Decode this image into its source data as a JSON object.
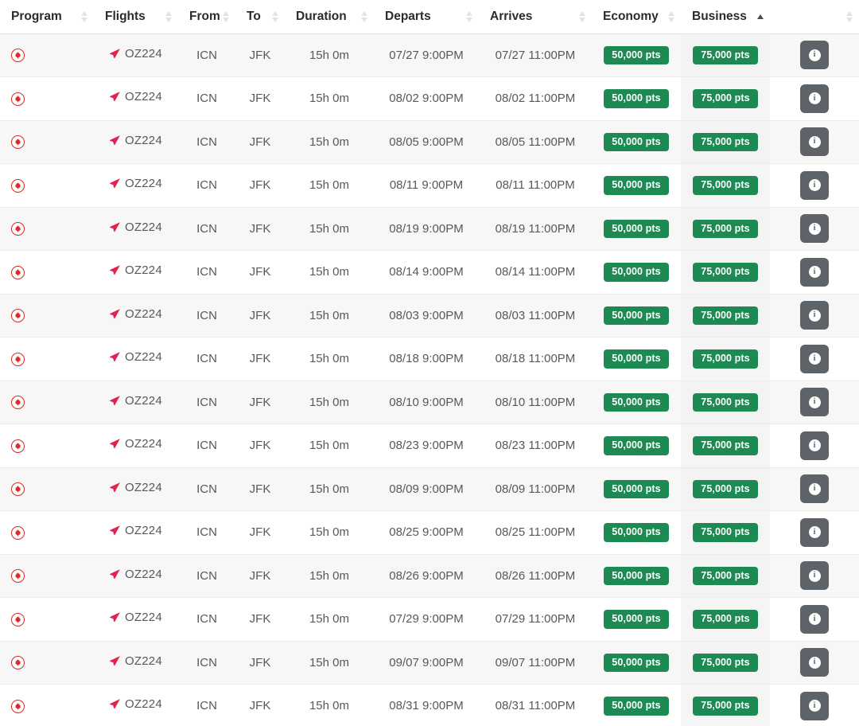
{
  "table": {
    "columns": [
      {
        "key": "program",
        "label": "Program",
        "sortable": true,
        "sort_state": "none"
      },
      {
        "key": "flights",
        "label": "Flights",
        "sortable": true,
        "sort_state": "none"
      },
      {
        "key": "from",
        "label": "From",
        "sortable": true,
        "sort_state": "none"
      },
      {
        "key": "to",
        "label": "To",
        "sortable": true,
        "sort_state": "none"
      },
      {
        "key": "duration",
        "label": "Duration",
        "sortable": true,
        "sort_state": "none"
      },
      {
        "key": "departs",
        "label": "Departs",
        "sortable": true,
        "sort_state": "none"
      },
      {
        "key": "arrives",
        "label": "Arrives",
        "sortable": true,
        "sort_state": "none"
      },
      {
        "key": "economy",
        "label": "Economy",
        "sortable": true,
        "sort_state": "none"
      },
      {
        "key": "business",
        "label": "Business",
        "sortable": true,
        "sort_state": "asc"
      },
      {
        "key": "actions",
        "label": "",
        "sortable": true,
        "sort_state": "none"
      }
    ],
    "program_icon": "aeroplan-maple-leaf-icon",
    "flight_icon": "airplane-icon",
    "info_icon": "info-circle-icon",
    "info_button_label": "i",
    "rows": [
      {
        "program": "Aeroplan",
        "flight": "OZ224",
        "from": "ICN",
        "to": "JFK",
        "duration": "15h 0m",
        "departs": "07/27 9:00PM",
        "arrives": "07/27 11:00PM",
        "economy": "50,000 pts",
        "business": "75,000 pts"
      },
      {
        "program": "Aeroplan",
        "flight": "OZ224",
        "from": "ICN",
        "to": "JFK",
        "duration": "15h 0m",
        "departs": "08/02 9:00PM",
        "arrives": "08/02 11:00PM",
        "economy": "50,000 pts",
        "business": "75,000 pts"
      },
      {
        "program": "Aeroplan",
        "flight": "OZ224",
        "from": "ICN",
        "to": "JFK",
        "duration": "15h 0m",
        "departs": "08/05 9:00PM",
        "arrives": "08/05 11:00PM",
        "economy": "50,000 pts",
        "business": "75,000 pts"
      },
      {
        "program": "Aeroplan",
        "flight": "OZ224",
        "from": "ICN",
        "to": "JFK",
        "duration": "15h 0m",
        "departs": "08/11 9:00PM",
        "arrives": "08/11 11:00PM",
        "economy": "50,000 pts",
        "business": "75,000 pts"
      },
      {
        "program": "Aeroplan",
        "flight": "OZ224",
        "from": "ICN",
        "to": "JFK",
        "duration": "15h 0m",
        "departs": "08/19 9:00PM",
        "arrives": "08/19 11:00PM",
        "economy": "50,000 pts",
        "business": "75,000 pts"
      },
      {
        "program": "Aeroplan",
        "flight": "OZ224",
        "from": "ICN",
        "to": "JFK",
        "duration": "15h 0m",
        "departs": "08/14 9:00PM",
        "arrives": "08/14 11:00PM",
        "economy": "50,000 pts",
        "business": "75,000 pts"
      },
      {
        "program": "Aeroplan",
        "flight": "OZ224",
        "from": "ICN",
        "to": "JFK",
        "duration": "15h 0m",
        "departs": "08/03 9:00PM",
        "arrives": "08/03 11:00PM",
        "economy": "50,000 pts",
        "business": "75,000 pts"
      },
      {
        "program": "Aeroplan",
        "flight": "OZ224",
        "from": "ICN",
        "to": "JFK",
        "duration": "15h 0m",
        "departs": "08/18 9:00PM",
        "arrives": "08/18 11:00PM",
        "economy": "50,000 pts",
        "business": "75,000 pts"
      },
      {
        "program": "Aeroplan",
        "flight": "OZ224",
        "from": "ICN",
        "to": "JFK",
        "duration": "15h 0m",
        "departs": "08/10 9:00PM",
        "arrives": "08/10 11:00PM",
        "economy": "50,000 pts",
        "business": "75,000 pts"
      },
      {
        "program": "Aeroplan",
        "flight": "OZ224",
        "from": "ICN",
        "to": "JFK",
        "duration": "15h 0m",
        "departs": "08/23 9:00PM",
        "arrives": "08/23 11:00PM",
        "economy": "50,000 pts",
        "business": "75,000 pts"
      },
      {
        "program": "Aeroplan",
        "flight": "OZ224",
        "from": "ICN",
        "to": "JFK",
        "duration": "15h 0m",
        "departs": "08/09 9:00PM",
        "arrives": "08/09 11:00PM",
        "economy": "50,000 pts",
        "business": "75,000 pts"
      },
      {
        "program": "Aeroplan",
        "flight": "OZ224",
        "from": "ICN",
        "to": "JFK",
        "duration": "15h 0m",
        "departs": "08/25 9:00PM",
        "arrives": "08/25 11:00PM",
        "economy": "50,000 pts",
        "business": "75,000 pts"
      },
      {
        "program": "Aeroplan",
        "flight": "OZ224",
        "from": "ICN",
        "to": "JFK",
        "duration": "15h 0m",
        "departs": "08/26 9:00PM",
        "arrives": "08/26 11:00PM",
        "economy": "50,000 pts",
        "business": "75,000 pts"
      },
      {
        "program": "Aeroplan",
        "flight": "OZ224",
        "from": "ICN",
        "to": "JFK",
        "duration": "15h 0m",
        "departs": "07/29 9:00PM",
        "arrives": "07/29 11:00PM",
        "economy": "50,000 pts",
        "business": "75,000 pts"
      },
      {
        "program": "Aeroplan",
        "flight": "OZ224",
        "from": "ICN",
        "to": "JFK",
        "duration": "15h 0m",
        "departs": "09/07 9:00PM",
        "arrives": "09/07 11:00PM",
        "economy": "50,000 pts",
        "business": "75,000 pts"
      },
      {
        "program": "Aeroplan",
        "flight": "OZ224",
        "from": "ICN",
        "to": "JFK",
        "duration": "15h 0m",
        "departs": "08/31 9:00PM",
        "arrives": "08/31 11:00PM",
        "economy": "50,000 pts",
        "business": "75,000 pts"
      }
    ]
  },
  "colors": {
    "badge_green": "#1d8a53",
    "program_red": "#d32b2b",
    "plane_red": "#e1224a",
    "info_button_gray": "#5d6368",
    "row_stripe": "#f7f7f7",
    "header_text": "#2b2b2b",
    "cell_text": "#585858"
  }
}
